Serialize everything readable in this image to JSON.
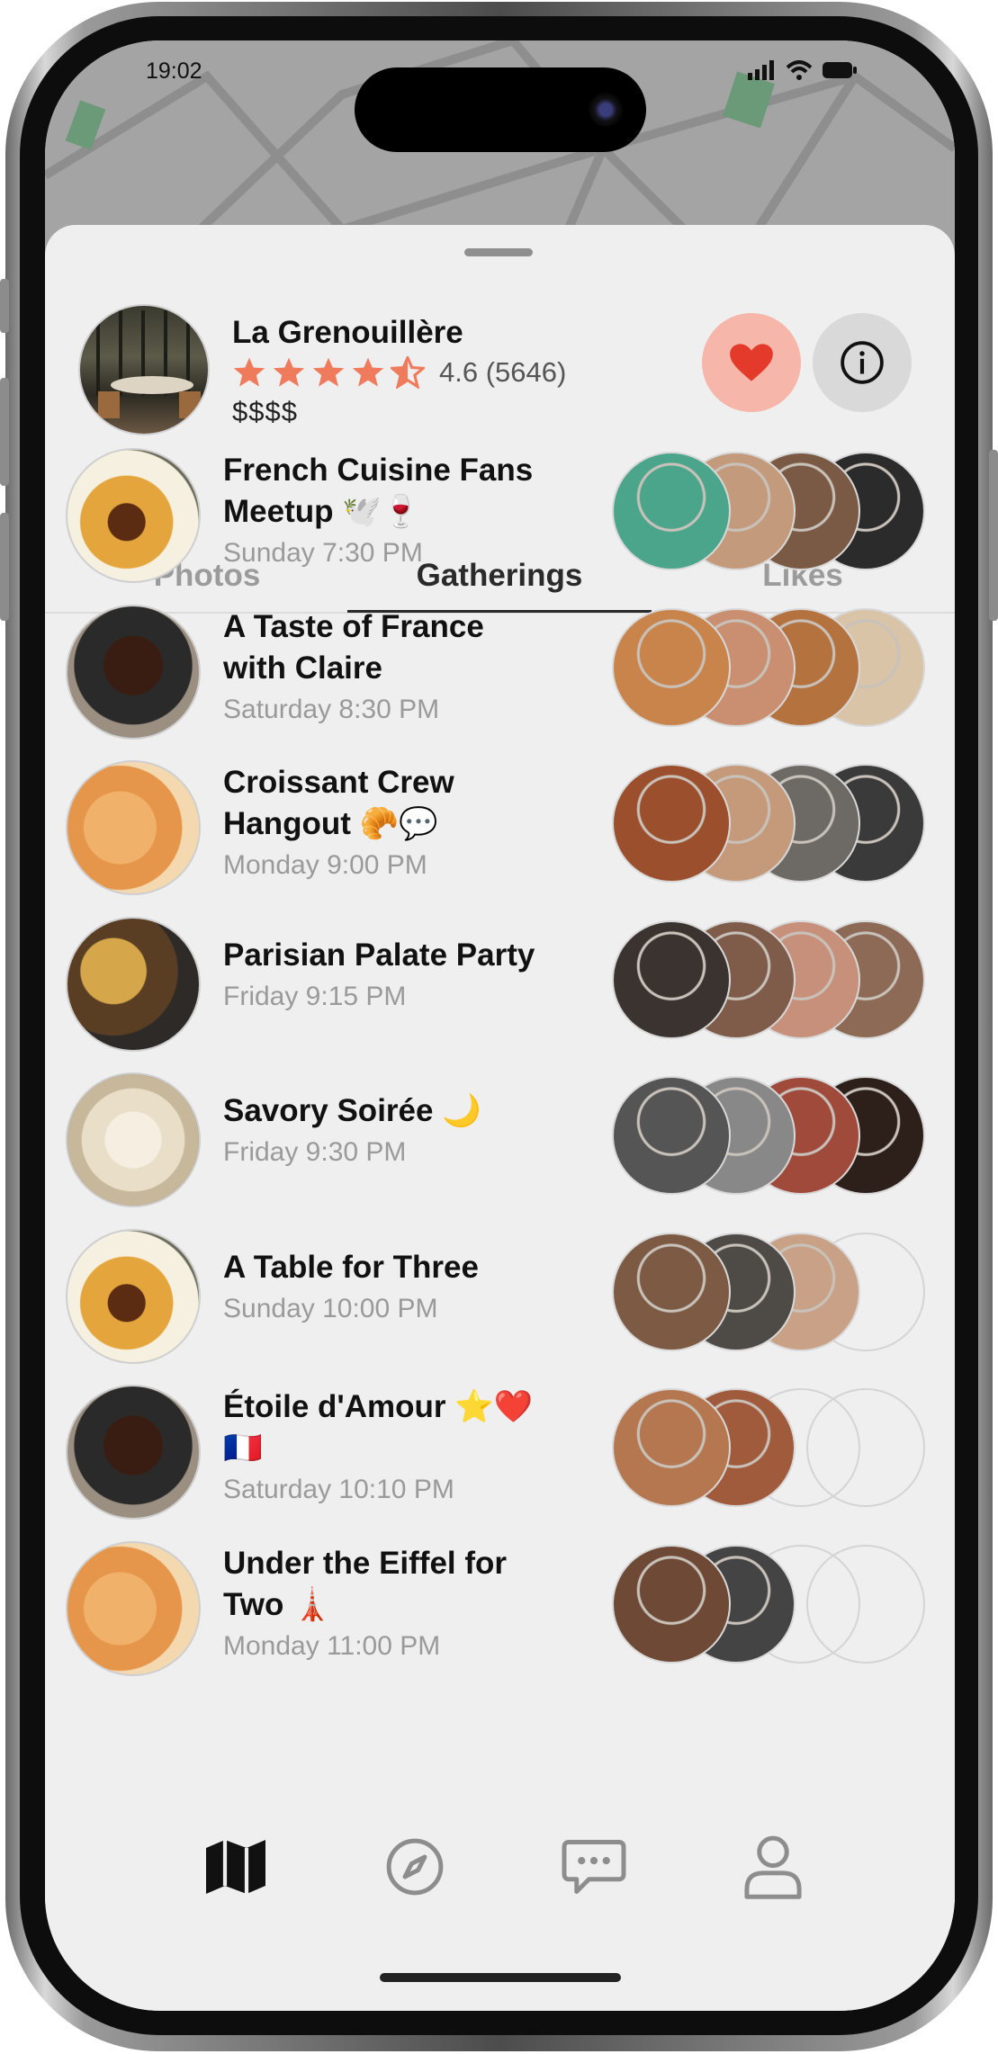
{
  "status_bar": {
    "time": "19:02"
  },
  "venue": {
    "name": "La Grenouillère",
    "rating": 4.6,
    "rating_text": "4.6 (5646)",
    "price": "$$$$",
    "accent_color": "#f07a5c"
  },
  "tabs": [
    {
      "label": "Photos",
      "active": false
    },
    {
      "label": "Gatherings",
      "active": true
    },
    {
      "label": "Likes",
      "active": false
    }
  ],
  "gatherings": [
    {
      "title_line1": "French Cuisine Fans",
      "title_line2": "Meetup 🕊️🍷",
      "time": "Sunday 7:30 PM",
      "food": "f1",
      "attendees": [
        "#4aa58a",
        "#c49a7c",
        "#7a5a45",
        "#2b2b2b"
      ]
    },
    {
      "title_line1": "A Taste of France",
      "title_line2": "with Claire",
      "time": "Saturday 8:30 PM",
      "food": "f2",
      "attendees": [
        "#c8844b",
        "#c98f70",
        "#b4723f",
        "#d9c4a8"
      ]
    },
    {
      "title_line1": "Croissant Crew",
      "title_line2": "Hangout 🥐💬",
      "time": "Monday 9:00 PM",
      "food": "f3",
      "attendees": [
        "#9b4f2c",
        "#c49a7a",
        "#6d6a66",
        "#3a3a3a"
      ]
    },
    {
      "title_line1": "Parisian Palate Party",
      "title_line2": "",
      "time": "Friday 9:15 PM",
      "food": "f4",
      "attendees": [
        "#3a332f",
        "#7f5b4a",
        "#c7907a",
        "#8d6a55"
      ]
    },
    {
      "title_line1": "Savory Soirée 🌙",
      "title_line2": "",
      "time": "Friday 9:30 PM",
      "food": "f5",
      "attendees": [
        "#555555",
        "#888888",
        "#a04a3c",
        "#2d1f1a"
      ]
    },
    {
      "title_line1": "A Table for Three",
      "title_line2": "",
      "time": "Sunday 10:00 PM",
      "food": "f1",
      "attendees": [
        "#7c5a44",
        "#4e4a46",
        "#c9a186",
        "empty"
      ]
    },
    {
      "title_line1": "Étoile d'Amour ⭐❤️",
      "title_line2": "🇫🇷",
      "time": "Saturday 10:10 PM",
      "food": "f2",
      "attendees": [
        "#b5774f",
        "#a05a3c",
        "empty",
        "empty"
      ]
    },
    {
      "title_line1": "Under the Eiffel for",
      "title_line2": "Two 🗼",
      "time": "Monday 11:00 PM",
      "food": "f3",
      "attendees": [
        "#6e4a36",
        "#444444",
        "empty",
        "empty"
      ]
    }
  ],
  "bottom_nav": [
    {
      "icon": "map-icon",
      "active": true
    },
    {
      "icon": "compass-icon",
      "active": false
    },
    {
      "icon": "chat-icon",
      "active": false
    },
    {
      "icon": "profile-icon",
      "active": false
    }
  ]
}
